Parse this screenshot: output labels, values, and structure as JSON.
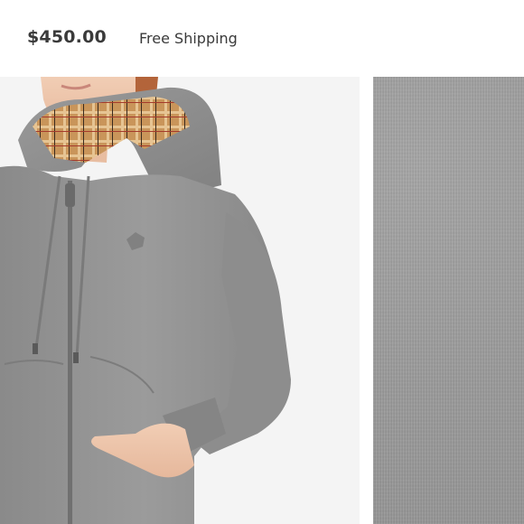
{
  "listing": {
    "price": "$450.00",
    "shipping": "Free Shipping"
  },
  "images": {
    "main_alt": "model-wearing-grey-hoodie",
    "detail_alt": "grey-fabric-swatch"
  },
  "colors": {
    "hoodie_grey": "#8f8f8f",
    "fabric_grey": "#9c9c9c",
    "check_lining": "#c9955a"
  }
}
